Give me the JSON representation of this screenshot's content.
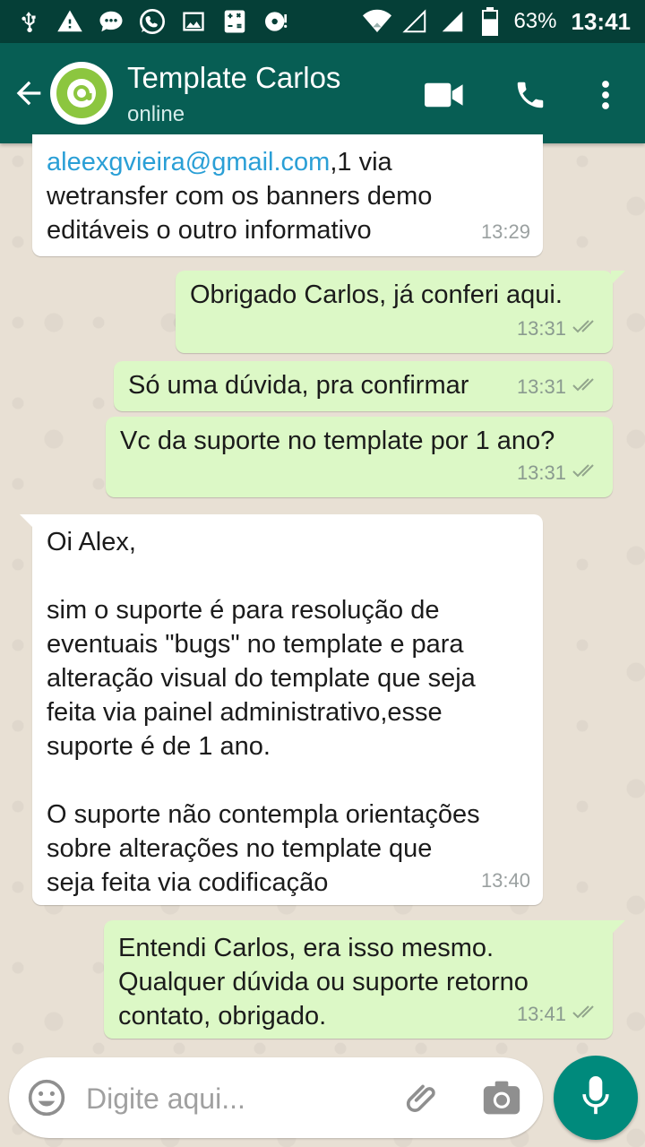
{
  "status_bar": {
    "battery": "63%",
    "time": "13:41"
  },
  "header": {
    "contact_name": "Template Carlos",
    "contact_status": "online"
  },
  "messages": [
    {
      "direction": "in",
      "link": "aleexgvieira@gmail.com",
      "text": ",1 via\nwetransfer com os banners demo\neditáveis o outro informativo",
      "time": "13:29"
    },
    {
      "direction": "out",
      "text": "Obrigado Carlos, já conferi aqui.",
      "time": "13:31",
      "status": "read"
    },
    {
      "direction": "out",
      "text": "Só uma dúvida, pra confirmar",
      "time": "13:31",
      "status": "read"
    },
    {
      "direction": "out",
      "text": "Vc da suporte no template por 1 ano?",
      "time": "13:31",
      "status": "read"
    },
    {
      "direction": "in",
      "text": "Oi Alex,\n\nsim o suporte é para resolução de\neventuais \"bugs\" no template e para\nalteração visual do template que seja\nfeita via painel administrativo,esse\nsuporte é de 1 ano.\n\nO suporte não contempla orientações\nsobre alterações no template que\nseja feita via codificação",
      "time": "13:40"
    },
    {
      "direction": "out",
      "text": "Entendi Carlos, era isso mesmo.\nQualquer dúvida ou suporte retorno\ncontato, obrigado.",
      "time": "13:41",
      "status": "read"
    }
  ],
  "composer": {
    "placeholder": "Digite aqui..."
  },
  "colors": {
    "header": "#075e54",
    "status_bar": "#053f37",
    "outgoing_bubble": "#dcf8c6",
    "incoming_bubble": "#ffffff",
    "accent": "#008a7c",
    "link": "#2a9fd6"
  },
  "icons": {
    "status_bar": [
      "usb-icon",
      "warning-icon",
      "chat-notification-icon",
      "whatsapp-icon",
      "image-icon",
      "calculator-icon",
      "music-icon",
      "wifi-icon",
      "signal-icon",
      "battery-icon"
    ],
    "header": [
      "back-arrow-icon",
      "video-call-icon",
      "phone-icon",
      "more-vert-icon"
    ],
    "composer": [
      "emoji-icon",
      "attach-icon",
      "camera-icon",
      "mic-icon"
    ]
  }
}
